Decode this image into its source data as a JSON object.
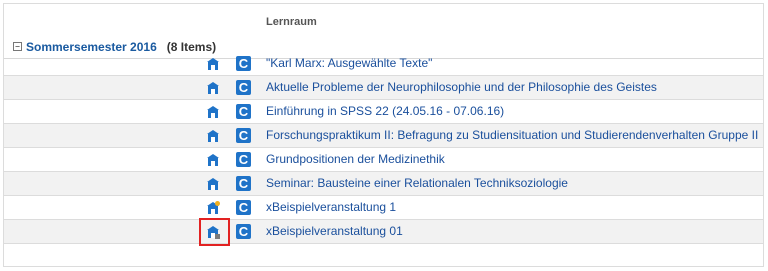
{
  "table": {
    "column_header": "Lernraum"
  },
  "group": {
    "toggle": "−",
    "title": "Sommersemester 2016",
    "count": "(8 Items)"
  },
  "items": [
    {
      "label": "\"Karl Marx: Ausgewählte Texte\"",
      "room_icon": "building-icon",
      "course_icon": "c-icon"
    },
    {
      "label": "Aktuelle Probleme der Neurophilosophie und der Philosophie des Geistes",
      "room_icon": "building-icon",
      "course_icon": "c-icon"
    },
    {
      "label": "Einführung in SPSS 22 (24.05.16 - 07.06.16)",
      "room_icon": "building-icon",
      "course_icon": "c-icon"
    },
    {
      "label": "Forschungspraktikum II: Befragung zu Studiensituation und Studierendenverhalten Gruppe II",
      "room_icon": "building-icon",
      "course_icon": "c-icon"
    },
    {
      "label": "Grundpositionen der Medizinethik",
      "room_icon": "building-icon",
      "course_icon": "c-icon"
    },
    {
      "label": "Seminar: Bausteine einer Relationalen Techniksoziologie",
      "room_icon": "building-icon",
      "course_icon": "c-icon"
    },
    {
      "label": "xBeispielveranstaltung 1",
      "room_icon": "building-star-icon",
      "course_icon": "c-icon"
    },
    {
      "label": "xBeispielveranstaltung 01",
      "room_icon": "building-edit-icon",
      "course_icon": "c-icon"
    }
  ],
  "course_icon_letter": "C",
  "colors": {
    "link": "#1a4f9c",
    "icon_blue": "#1f73c8",
    "highlight": "#e22222"
  }
}
